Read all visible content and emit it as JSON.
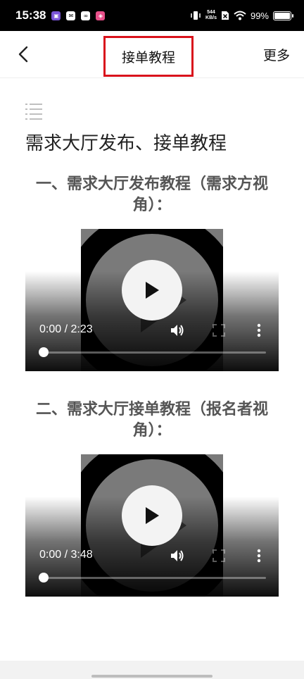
{
  "status_bar": {
    "time": "15:38",
    "net_speed_value": "544",
    "net_speed_unit": "KB/s",
    "battery_percent": "99%",
    "battery_level": 0.99
  },
  "nav": {
    "title": "接单教程",
    "more_label": "更多"
  },
  "article": {
    "title": "需求大厅发布、接单教程",
    "sections": [
      {
        "heading": "一、需求大厅发布教程（需求方视角）：",
        "video": {
          "time": "0:00 / 2:23",
          "progress": 0
        }
      },
      {
        "heading": "二、需求大厅接单教程（报名者视角）：",
        "video": {
          "time": "0:00 / 3:48",
          "progress": 0
        }
      }
    ]
  },
  "colors": {
    "highlight_border": "#d9121c",
    "heading_text": "#555555",
    "title_text": "#222222"
  }
}
